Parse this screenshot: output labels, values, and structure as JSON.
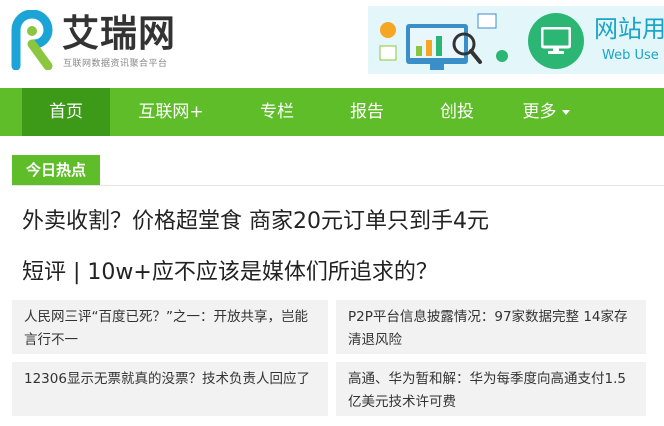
{
  "site": {
    "name": "艾瑞网",
    "tagline": "互联网数据资讯聚合平台"
  },
  "banner": {
    "title": "网站用",
    "subtitle": "Web Use"
  },
  "nav": {
    "items": [
      {
        "label": "首页",
        "active": true
      },
      {
        "label": "互联网+"
      },
      {
        "label": "专栏"
      },
      {
        "label": "报告"
      },
      {
        "label": "创投"
      },
      {
        "label": "更多"
      }
    ]
  },
  "hot": {
    "label": "今日热点"
  },
  "headlines": [
    "外卖收割？价格超堂食 商家20元订单只到手4元",
    "短评 | 10w+应不应该是媒体们所追求的？"
  ],
  "cards": [
    "人民网三评“百度已死？”之一：开放共享，岂能言行不一",
    "P2P平台信息披露情况：97家数据完整 14家存清退风险",
    "12306显示无票就真的没票？技术负责人回应了",
    "高通、华为暂和解：华为每季度向高通支付1.5亿美元技术许可费"
  ],
  "colors": {
    "nav_green": "#5fbd2a",
    "nav_active": "#3d9a18",
    "banner_bg": "#e3f6fa"
  }
}
